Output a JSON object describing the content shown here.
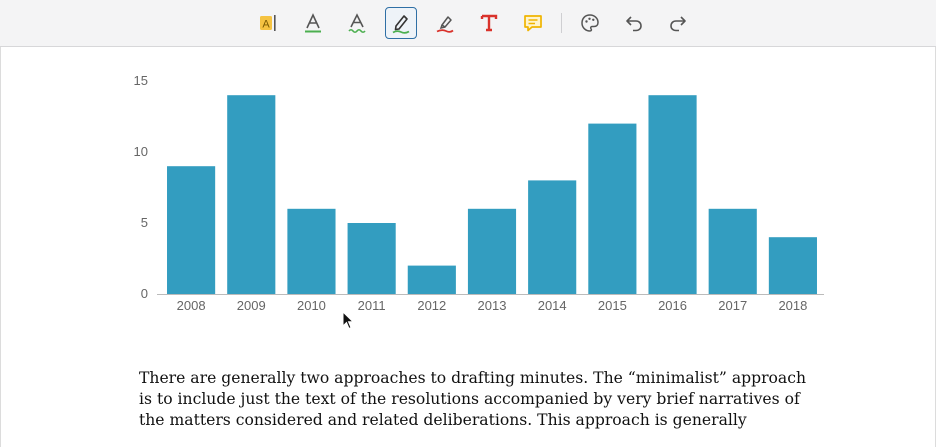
{
  "toolbar": {
    "tools": [
      {
        "name": "highlight-text-tool",
        "icon": "highlight-text-icon",
        "active": false
      },
      {
        "name": "underline-tool",
        "icon": "underline-text-icon",
        "active": false
      },
      {
        "name": "squiggly-tool",
        "icon": "squiggly-underline-icon",
        "active": false
      },
      {
        "name": "freehand-pen-tool",
        "icon": "pen-icon",
        "active": true
      },
      {
        "name": "freehand-highlighter-tool",
        "icon": "highlighter-icon",
        "active": false
      },
      {
        "name": "free-text-tool",
        "icon": "text-t-icon",
        "active": false
      },
      {
        "name": "sticky-note-tool",
        "icon": "comment-icon",
        "active": false
      },
      {
        "name": "style-palette-tool",
        "icon": "palette-icon",
        "active": false
      },
      {
        "name": "undo-tool",
        "icon": "undo-icon",
        "active": false
      },
      {
        "name": "redo-tool",
        "icon": "redo-icon",
        "active": false
      }
    ],
    "colors": {
      "accent": "#2f6fa5",
      "highlight": "#f5c342",
      "underline": "#4caf50",
      "ink": "#d9322b",
      "note": "#f0b400"
    }
  },
  "chart_data": {
    "type": "bar",
    "categories": [
      "2008",
      "2009",
      "2010",
      "2011",
      "2012",
      "2013",
      "2014",
      "2015",
      "2016",
      "2017",
      "2018"
    ],
    "values": [
      9,
      14,
      6,
      5,
      2,
      6,
      8,
      12,
      14,
      6,
      4
    ],
    "ylim": [
      0,
      15
    ],
    "yticks": [
      0,
      5,
      10,
      15
    ],
    "bar_color": "#339dc0",
    "grid": false,
    "title": "",
    "xlabel": "",
    "ylabel": ""
  },
  "document": {
    "paragraph_lines": [
      "There are generally two approaches to drafting minutes. The “minimalist” approach",
      "is to include just the text of the resolutions accompanied by very brief narratives of",
      "the matters considered and related deliberations. This approach is generally"
    ]
  }
}
